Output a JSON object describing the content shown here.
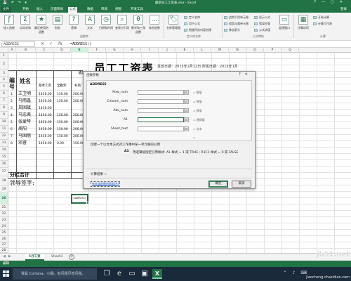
{
  "window": {
    "title": "最新员工工资表.xlsx - Excel",
    "controls": [
      "?",
      "—",
      "▢",
      "✕"
    ],
    "quick_access": "💾 ↶ ↷ ▾"
  },
  "tabs": {
    "items": [
      "文件",
      "开始",
      "插入",
      "页面布局",
      "公式",
      "数据",
      "审阅",
      "视图",
      "开发工具"
    ],
    "active_index": 4,
    "sign_in": "登录"
  },
  "ribbon": {
    "buttons": [
      {
        "label": "插入函数",
        "icon": "fx-icon"
      },
      {
        "label": "自动求和",
        "icon": "sum-icon"
      },
      {
        "label": "最近使用的函数",
        "icon": "star-icon"
      },
      {
        "label": "财务",
        "icon": "book-icon"
      },
      {
        "label": "逻辑",
        "icon": "question-icon"
      },
      {
        "label": "文本",
        "icon": "text-icon"
      },
      {
        "label": "日期和时间",
        "icon": "clock-icon"
      },
      {
        "label": "查找与引用",
        "icon": "search-icon"
      },
      {
        "label": "数学和三角函数",
        "icon": "theta-icon"
      },
      {
        "label": "其他函数",
        "icon": "more-icon"
      },
      {
        "label": "名称管理器",
        "icon": "tag-icon"
      },
      {
        "label": "计算选项",
        "icon": "calc-icon"
      }
    ],
    "small_buttons": [
      "定义名称",
      "用于公式",
      "根据所选内容创建",
      "追踪引用单元格",
      "追踪从属单元格",
      "移去箭头",
      "显示公式",
      "错误检查",
      "公式求值",
      "监视窗口",
      "开始计算",
      "计算工作表"
    ],
    "groups": [
      "函数库",
      "定义的名称",
      "公式审核",
      "计算"
    ]
  },
  "formula_bar": {
    "name_box": "ADDRESS",
    "buttons": [
      "✕",
      "✓",
      "fx"
    ],
    "formula": "=ADDRESS()"
  },
  "columns": [
    "A",
    "B",
    "C",
    "D",
    "E",
    "F",
    "G",
    "H",
    "I",
    "J",
    "K",
    "L",
    "M",
    "N",
    "O",
    "P",
    "Q"
  ],
  "selected_column": "E",
  "rows": [
    "1",
    "2",
    "3",
    "4",
    "5",
    "6",
    "7",
    "8",
    "9",
    "10",
    "11",
    "12",
    "13",
    "14",
    "15",
    "16",
    "17",
    "18",
    "19",
    "20",
    "21",
    "22",
    "23",
    "24",
    "25",
    "26",
    "27",
    "28",
    "29",
    "30",
    "31"
  ],
  "selected_row": "20",
  "sheet": {
    "title": "员工工资表",
    "subtitle": "发放日期：2015年2月12日  所属日期：2015年1月",
    "col_no": "编号",
    "col_name": "姓名",
    "col_group": "应发金额",
    "subheaders": [
      "基本工资",
      "全勤奖",
      "补助"
    ],
    "employees": [
      {
        "no": "1",
        "name": "王卫明",
        "base": "1450.00",
        "bonus": "150.00",
        "sub": "200.00"
      },
      {
        "no": "2",
        "name": "马雨鑫",
        "base": "1450.00",
        "bonus": "150.00",
        "sub": "200.00"
      },
      {
        "no": "3",
        "name": "郑固斌",
        "base": "1450.00",
        "bonus": "",
        "sub": ""
      },
      {
        "no": "4",
        "name": "马忠夷",
        "base": "1450.00",
        "bonus": "150.00",
        "sub": "200.00"
      },
      {
        "no": "5",
        "name": "张爱琴",
        "base": "1450.00",
        "bonus": "150.00",
        "sub": "200.00"
      },
      {
        "no": "6",
        "name": "周阳",
        "base": "1450.00",
        "bonus": "150.00",
        "sub": "200.00"
      },
      {
        "no": "7",
        "name": "马国丽",
        "base": "1450.00",
        "bonus": "150.00",
        "sub": "200.00"
      },
      {
        "no": "8",
        "name": "邓睿",
        "base": "1450.00",
        "bonus": "0.00",
        "sub": "150.00"
      }
    ],
    "subtotal": "分栏合计",
    "signature": "领导签字:",
    "active_cell": "=ADDRESS()"
  },
  "dialog": {
    "title": "函数参数",
    "controls": [
      "?",
      "✕"
    ],
    "function_name": "ADDRESS",
    "args": [
      {
        "label": "Row_num",
        "hint": "= 数值"
      },
      {
        "label": "Column_num",
        "hint": "= 数值"
      },
      {
        "label": "Abs_num",
        "hint": "= 数值"
      },
      {
        "label": "A1",
        "hint": "= 逻辑值"
      },
      {
        "label": "Sheet_text",
        "hint": "= 文本"
      }
    ],
    "equals_line": "=",
    "description": "创建一个以文本方式对工作簿中某一单元格的引用",
    "arg_name": "A1",
    "arg_description": "用逻辑值指定引用样式: A1 样式 = 1 或 TRUE ; R1C1 样式 = 0 或 FALSE",
    "result_label": "计算结果 =",
    "help_link": "有关该函数的帮助(H)",
    "ok": "确定",
    "cancel": "取消"
  },
  "sheet_tabs": {
    "nav": [
      "◀",
      "▶"
    ],
    "tabs": [
      "5月工资",
      "Sheet3"
    ],
    "active_index": 0,
    "add": "+"
  },
  "status": {
    "mode": "编辑"
  },
  "taskbar": {
    "search_placeholder": "我是 Cortana，小娜。有问题尽管问我。",
    "tray": "⌃ ♪ ⌨"
  },
  "watermark": {
    "line1": "jb51.net",
    "line2": "jiaocheng.chazidian.com"
  }
}
